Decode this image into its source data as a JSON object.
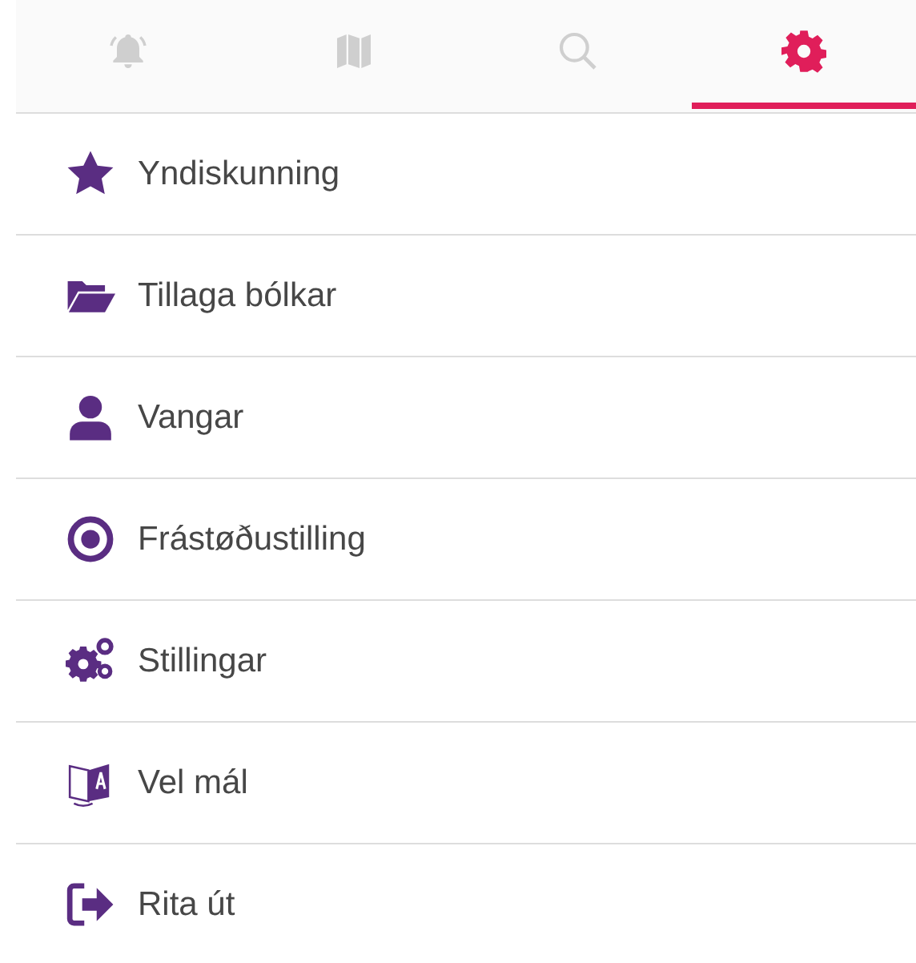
{
  "tabs": [
    {
      "kind": "bell",
      "selected": false
    },
    {
      "kind": "map",
      "selected": false
    },
    {
      "kind": "search",
      "selected": false
    },
    {
      "kind": "settings",
      "selected": true
    }
  ],
  "menu": [
    {
      "kind": "star",
      "label": "Yndiskunning"
    },
    {
      "kind": "folder",
      "label": "Tillaga bólkar"
    },
    {
      "kind": "user",
      "label": "Vangar"
    },
    {
      "kind": "target",
      "label": "Frástøðustilling"
    },
    {
      "kind": "gears",
      "label": "Stillingar"
    },
    {
      "kind": "translate",
      "label": "Vel mál"
    },
    {
      "kind": "logout",
      "label": "Rita út"
    }
  ]
}
